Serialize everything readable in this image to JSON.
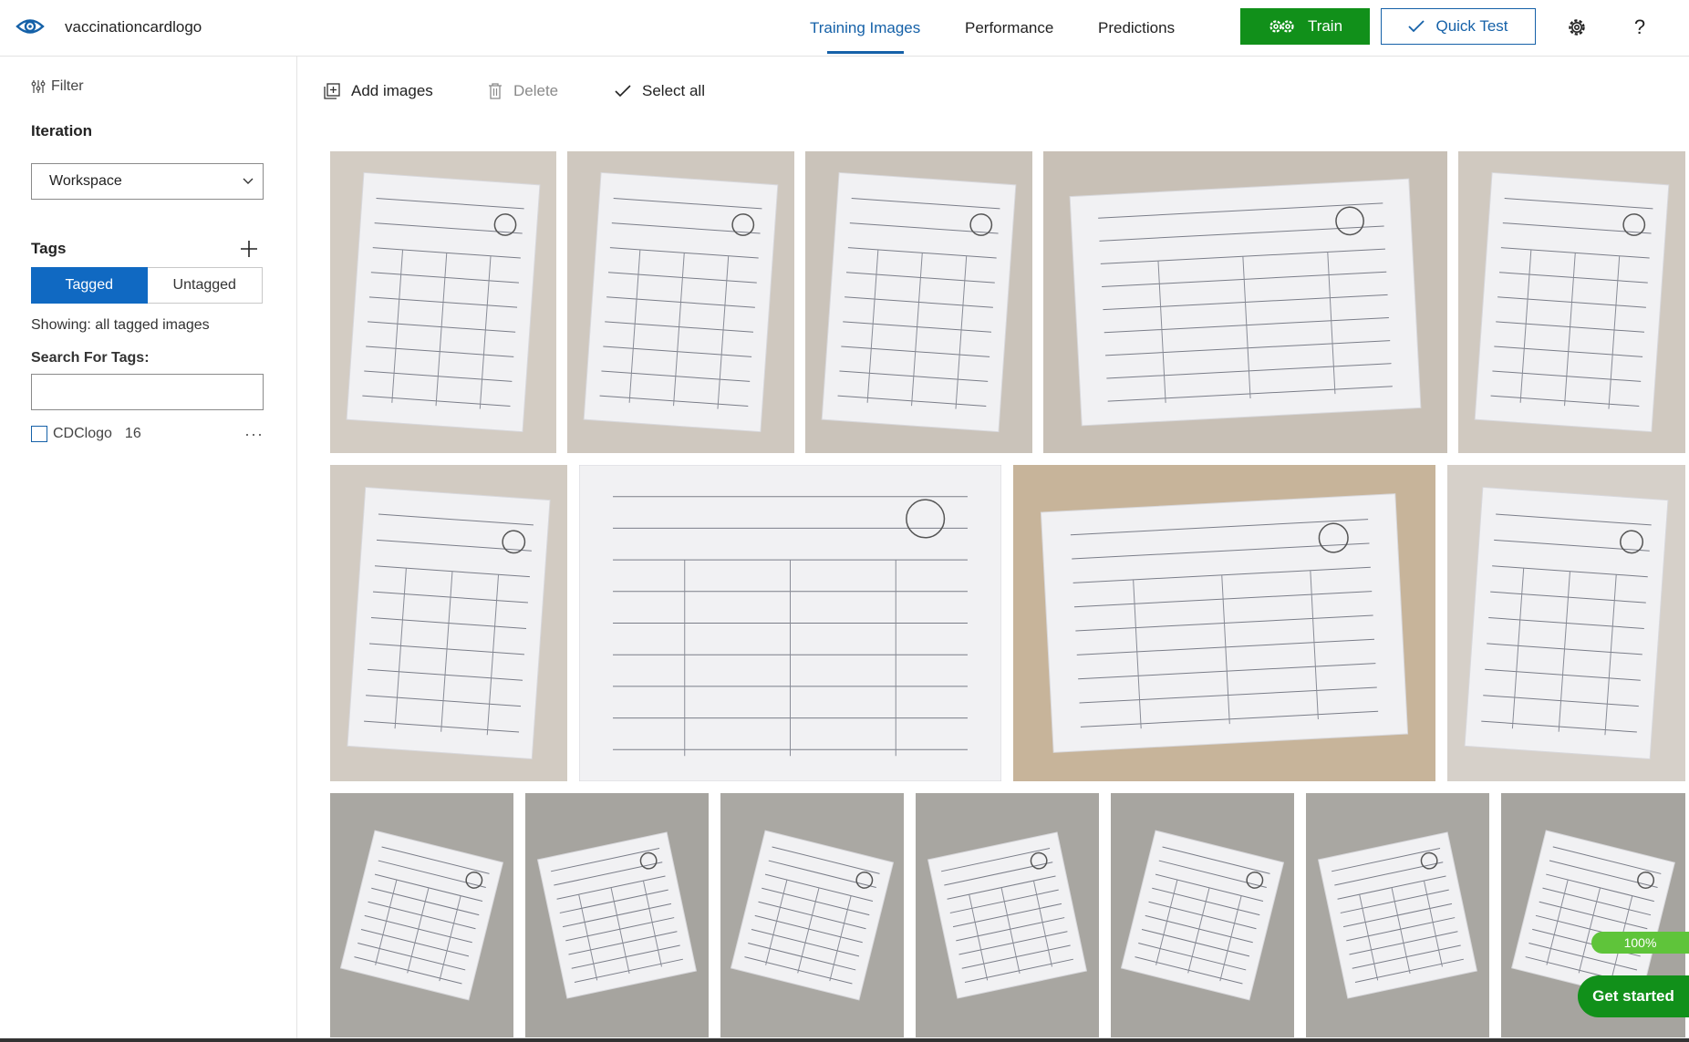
{
  "app": {
    "project_name": "vaccinationcardlogo"
  },
  "nav": {
    "tabs": [
      {
        "label": "Training Images",
        "active": true
      },
      {
        "label": "Performance",
        "active": false
      },
      {
        "label": "Predictions",
        "active": false
      }
    ],
    "train_label": "Train",
    "quick_test_label": "Quick Test",
    "settings_icon": "gear-icon",
    "help_icon": "question-icon",
    "help_glyph": "?"
  },
  "sidebar": {
    "filter_label": "Filter",
    "iteration_heading": "Iteration",
    "iteration_value": "Workspace",
    "tags_heading": "Tags",
    "toggle": {
      "tagged": "Tagged",
      "untagged": "Untagged",
      "selected": "Tagged"
    },
    "showing_text": "Showing: all tagged images",
    "search_label": "Search For Tags:",
    "search_value": "",
    "tags": [
      {
        "name": "CDClogo",
        "count": "16",
        "checked": false
      }
    ],
    "more_glyph": "···"
  },
  "toolbar": {
    "add_images": "Add images",
    "delete": "Delete",
    "select_all": "Select all"
  },
  "images": [
    {
      "kind": "tilted-card",
      "bg": "#d3ccc3"
    },
    {
      "kind": "tilted-card",
      "bg": "#cfc8bf"
    },
    {
      "kind": "tilted-card",
      "bg": "#cac3ba"
    },
    {
      "kind": "flat-card",
      "bg": "#c8c0b6"
    },
    {
      "kind": "tilted-card",
      "bg": "#d0c9c0"
    },
    {
      "kind": "tilted-card",
      "bg": "#d2cbc2"
    },
    {
      "kind": "closeup-card",
      "bg": "#e8e6e3"
    },
    {
      "kind": "flat-card",
      "bg": "#c7b49a"
    },
    {
      "kind": "tilted-card",
      "bg": "#d6d0c9"
    },
    {
      "kind": "small-card",
      "bg": "#a9a7a2"
    },
    {
      "kind": "small-card",
      "bg": "#a6a49f"
    },
    {
      "kind": "small-card",
      "bg": "#aaa8a3"
    },
    {
      "kind": "small-card",
      "bg": "#a8a6a1"
    },
    {
      "kind": "small-card",
      "bg": "#a7a5a0"
    },
    {
      "kind": "small-card",
      "bg": "#a9a7a2"
    },
    {
      "kind": "small-card",
      "bg": "#a6a49f"
    }
  ],
  "overlays": {
    "progress_text": "100%",
    "progress": 1.0,
    "get_started": "Get started"
  },
  "colors": {
    "accent": "#1561a8",
    "train_green": "#11901a",
    "tag_blue": "#1069c2"
  }
}
